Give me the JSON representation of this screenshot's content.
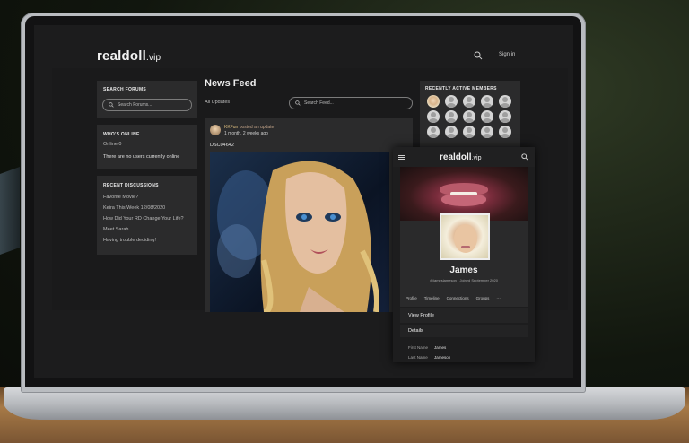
{
  "header": {
    "logo_main": "realdoll",
    "logo_suffix": ".vip",
    "sign_in": "Sign in"
  },
  "sidebar": {
    "search_title": "SEARCH FORUMS",
    "search_placeholder": "Search Forums...",
    "whos_online_title": "WHO'S ONLINE",
    "online_count": "Online 0",
    "no_users": "There are no users currently online",
    "recent_title": "RECENT DISCUSSIONS",
    "discussions": [
      "Favorite Movie?",
      "Keira This Week 12/08/2020",
      "How Did Your RD Change Your Life?",
      "Meet Sarah",
      "Having trouble deciding!"
    ]
  },
  "feed": {
    "title": "News Feed",
    "filter": "All Updates",
    "search_placeholder": "Search Feed...",
    "post": {
      "author": "KKFun",
      "action": "posted an update",
      "time": "1 month, 2 weeks ago",
      "caption": "DSC04642"
    }
  },
  "members": {
    "title": "RECENTLY ACTIVE MEMBERS",
    "count": 15
  },
  "mobile": {
    "logo_main": "realdoll",
    "logo_suffix": ".vip",
    "name": "James",
    "handle_joined": "@jamesjameson · Joined September 2020",
    "tabs": [
      "Profile",
      "Timeline",
      "Connections",
      "Groups",
      "···"
    ],
    "view_profile": "View Profile",
    "details_title": "Details",
    "fields": [
      {
        "label": "First Name",
        "value": "James"
      },
      {
        "label": "Last Name",
        "value": "Jameson"
      }
    ]
  }
}
